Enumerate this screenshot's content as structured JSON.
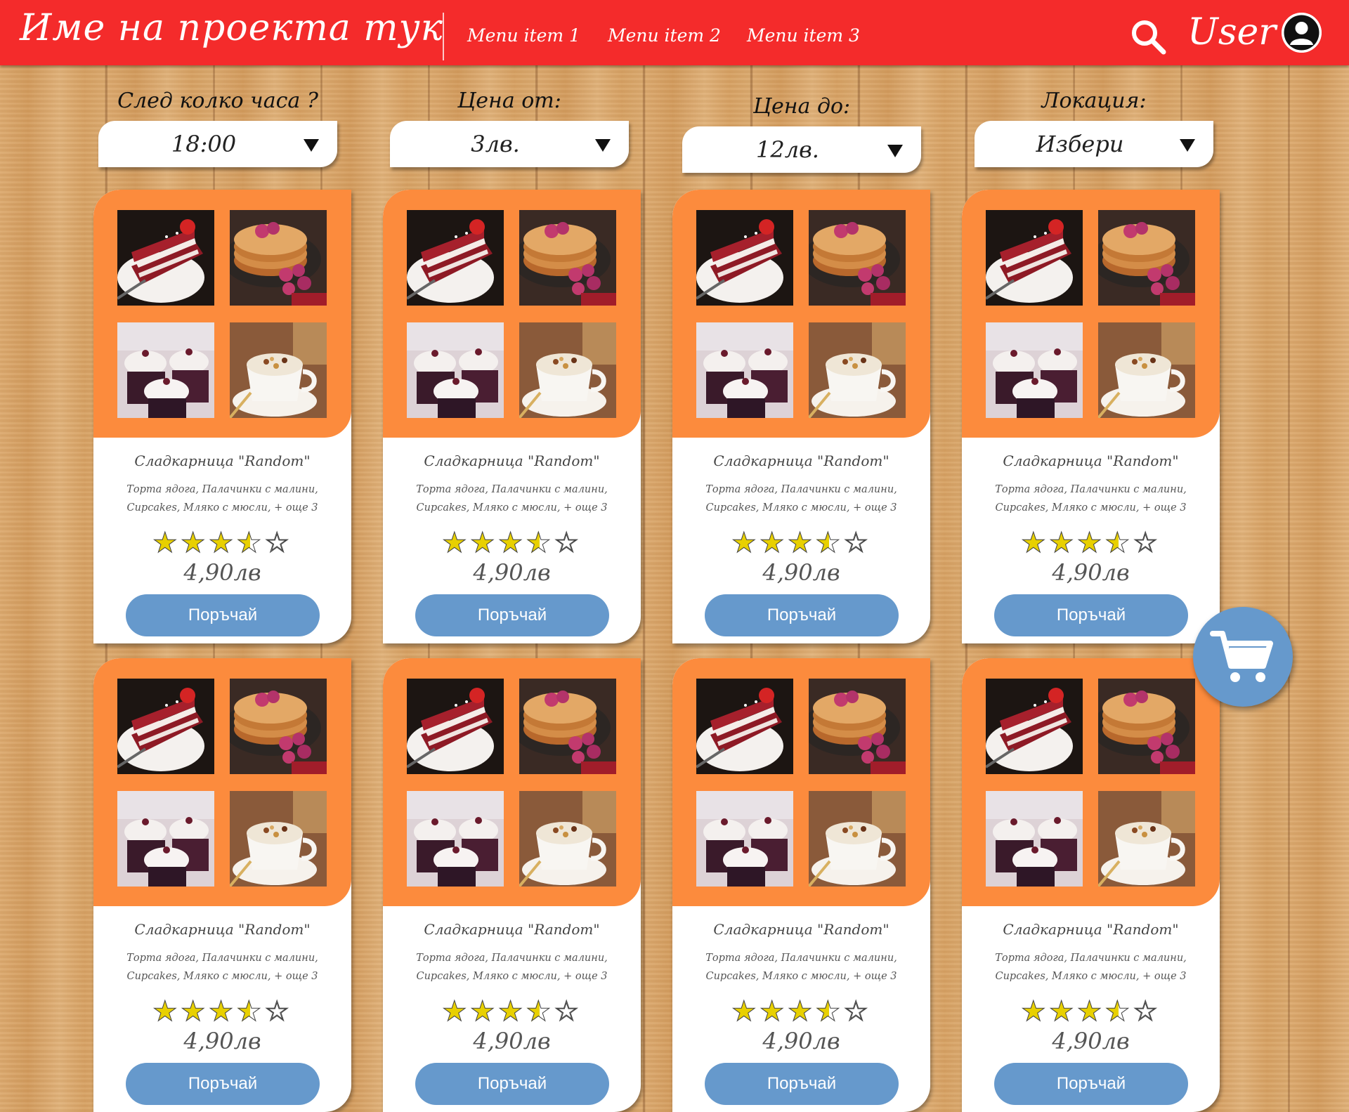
{
  "header": {
    "brand": "Име на проекта тук",
    "menu": [
      "Menu item 1",
      "Menu item 2",
      "Menu item 3"
    ],
    "user_label": "User",
    "icons": {
      "search": "search-icon",
      "avatar": "user-avatar-icon"
    }
  },
  "filters": [
    {
      "label": "След колко часа ?",
      "value": "18:00"
    },
    {
      "label": "Цена от:",
      "value": "3лв."
    },
    {
      "label": "Цена до:",
      "value": "12лв."
    },
    {
      "label": "Локация:",
      "value": "Избери"
    }
  ],
  "cards": [
    {
      "shop": "Сладкарница \"Random\"",
      "desc_line1": "Торта ядога, Палачинки с малини,",
      "desc_line2": "Cupcakes, Мляко с мюсли, + още 3",
      "rating": 3.5,
      "price": "4,90лв",
      "order_label": "Поръчай"
    },
    {
      "shop": "Сладкарница \"Random\"",
      "desc_line1": "Торта ядога, Палачинки с малини,",
      "desc_line2": "Cupcakes, Мляко с мюсли, + още 3",
      "rating": 3.5,
      "price": "4,90лв",
      "order_label": "Поръчай"
    },
    {
      "shop": "Сладкарница \"Random\"",
      "desc_line1": "Торта ядога, Палачинки с малини,",
      "desc_line2": "Cupcakes, Мляко с мюсли, + още 3",
      "rating": 3.5,
      "price": "4,90лв",
      "order_label": "Поръчай"
    },
    {
      "shop": "Сладкарница \"Random\"",
      "desc_line1": "Торта ядога, Палачинки с малини,",
      "desc_line2": "Cupcakes, Мляко с мюсли, + още 3",
      "rating": 3.5,
      "price": "4,90лв",
      "order_label": "Поръчай"
    },
    {
      "shop": "Сладкарница \"Random\"",
      "desc_line1": "Торта ядога, Палачинки с малини,",
      "desc_line2": "Cupcakes, Мляко с мюсли, + още 3",
      "rating": 3.5,
      "price": "4,90лв",
      "order_label": "Поръчай"
    },
    {
      "shop": "Сладкарница \"Random\"",
      "desc_line1": "Торта ядога, Палачинки с малини,",
      "desc_line2": "Cupcakes, Мляко с мюсли, + още 3",
      "rating": 3.5,
      "price": "4,90лв",
      "order_label": "Поръчай"
    },
    {
      "shop": "Сладкарница \"Random\"",
      "desc_line1": "Торта ядога, Палачинки с малини,",
      "desc_line2": "Cupcakes, Мляко с мюсли, + още 3",
      "rating": 3.5,
      "price": "4,90лв",
      "order_label": "Поръчай"
    },
    {
      "shop": "Сладкарница \"Random\"",
      "desc_line1": "Торта ядога, Палачинки с малини,",
      "desc_line2": "Cupcakes, Мляко с мюсли, + още 3",
      "rating": 3.5,
      "price": "4,90лв",
      "order_label": "Поръчай"
    }
  ],
  "food_images": [
    "red-velvet-cake-image",
    "pancakes-raspberries-image",
    "cupcakes-image",
    "milk-muesli-image"
  ],
  "cart": {
    "icon": "shopping-cart-icon"
  },
  "colors": {
    "header": "#f42b2b",
    "card_top": "#fc8b3d",
    "button": "#6699cc",
    "star": "#e8d000"
  }
}
